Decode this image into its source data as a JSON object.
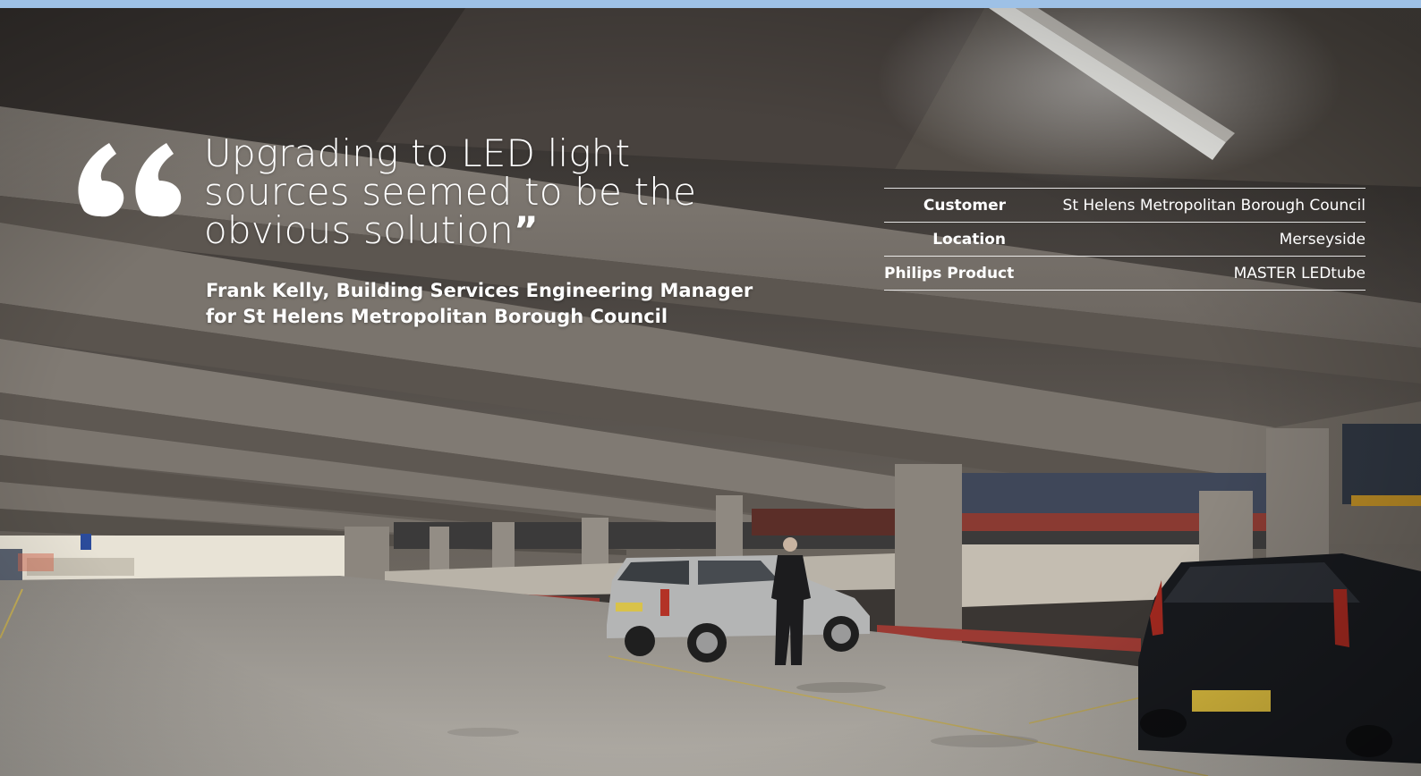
{
  "quote": {
    "lines": [
      "Upgrading to LED light",
      "sources seemed to be the",
      "obvious solution"
    ],
    "closing_mark": "”"
  },
  "attribution": {
    "line1": "Frank Kelly, Building Services Engineering Manager",
    "line2": "for St Helens Metropolitan Borough Council"
  },
  "details": [
    {
      "label": "Customer",
      "value": "St Helens Metropolitan Borough Council"
    },
    {
      "label": "Location",
      "value": "Merseyside"
    },
    {
      "label": "Philips Product",
      "value": "MASTER LEDtube"
    }
  ],
  "colors": {
    "accent_bar": "#9ec1e6",
    "text": "#ffffff"
  },
  "icons": {
    "quote": "open-quote-icon"
  }
}
